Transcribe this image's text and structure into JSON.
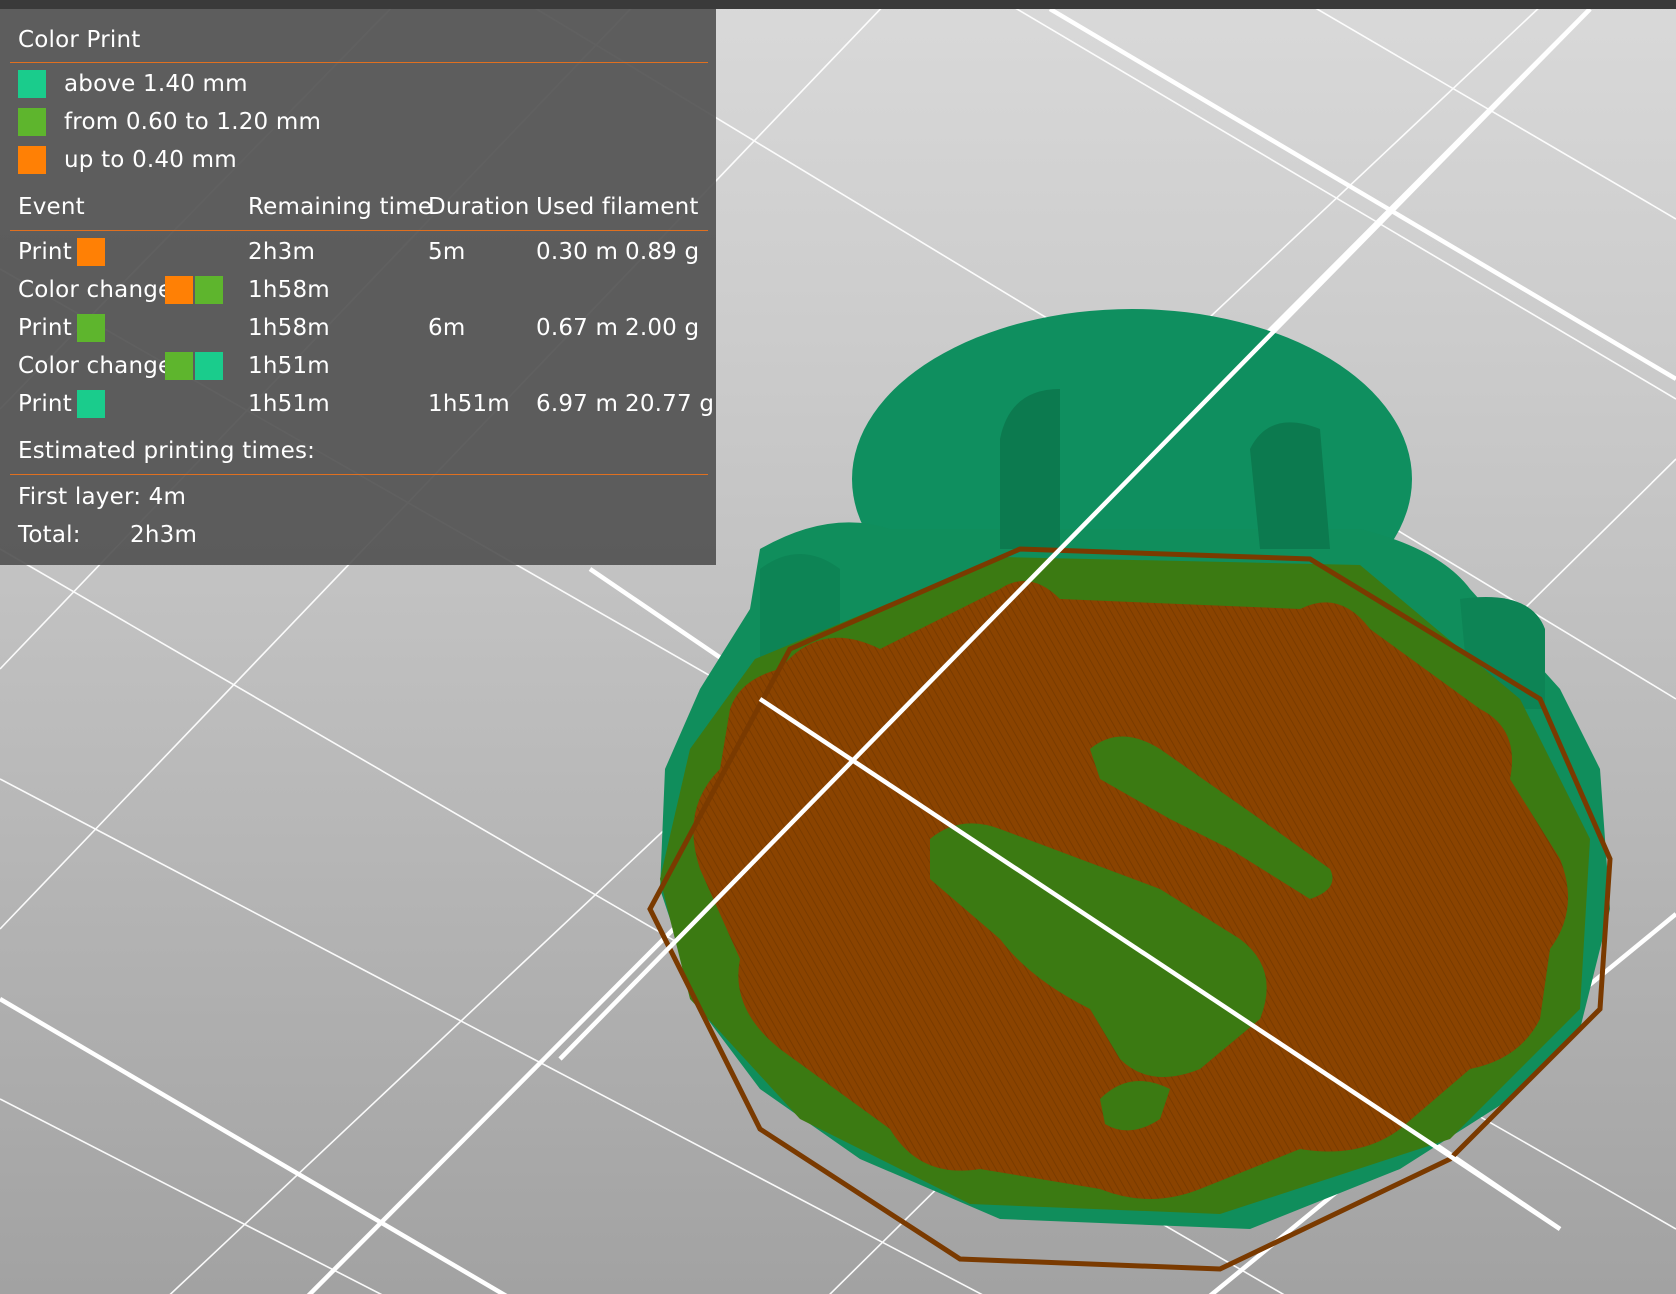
{
  "colors": {
    "teal": "#1acc8c",
    "green": "#5eb52d",
    "orange": "#ff8005",
    "separator": "#e07020",
    "model_teal": "#119560",
    "model_brown": "#8a4300",
    "model_green": "#3b7a12"
  },
  "legend": {
    "title": "Color Print",
    "ranges": [
      {
        "label": "above 1.40 mm",
        "color": "#1acc8c"
      },
      {
        "label": "from 0.60 to 1.20 mm",
        "color": "#5eb52d"
      },
      {
        "label": "up to 0.40 mm",
        "color": "#ff8005"
      }
    ],
    "headers": {
      "event": "Event",
      "remaining": "Remaining time",
      "duration": "Duration",
      "filament": "Used filament"
    },
    "events": [
      {
        "name": "Print",
        "colors": [
          "#ff8005"
        ],
        "remaining": "2h3m",
        "duration": "5m",
        "length": "0.30 m",
        "weight": "0.89 g"
      },
      {
        "name": "Color change",
        "colors": [
          "#ff8005",
          "#5eb52d"
        ],
        "remaining": "1h58m",
        "duration": "",
        "length": "",
        "weight": ""
      },
      {
        "name": "Print",
        "colors": [
          "#5eb52d"
        ],
        "remaining": "1h58m",
        "duration": "6m",
        "length": "0.67 m",
        "weight": "2.00 g"
      },
      {
        "name": "Color change",
        "colors": [
          "#5eb52d",
          "#1acc8c"
        ],
        "remaining": "1h51m",
        "duration": "",
        "length": "",
        "weight": ""
      },
      {
        "name": "Print",
        "colors": [
          "#1acc8c"
        ],
        "remaining": "1h51m",
        "duration": "1h51m",
        "length": "6.97 m",
        "weight": "20.77 g"
      }
    ],
    "estimated_title": "Estimated printing times:",
    "first_layer": "First layer: 4m",
    "total_label": "Total:",
    "total_value": "2h3m"
  }
}
